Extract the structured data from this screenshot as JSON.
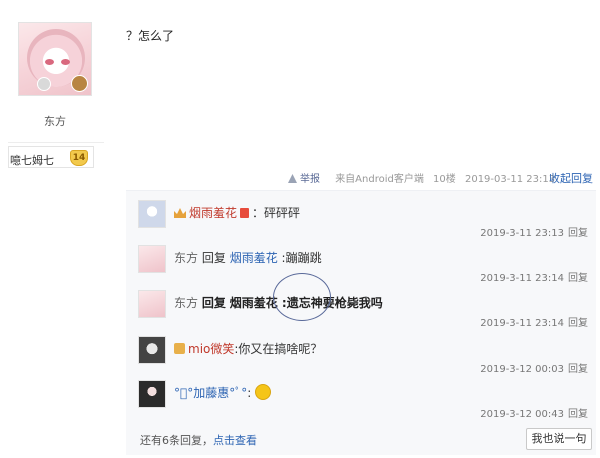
{
  "post": {
    "author": "东方",
    "level_name": "噫七姆七",
    "level_num": "14",
    "text": "？怎么了",
    "report": "举报",
    "source": "来自Android客户端",
    "floor": "10楼",
    "time": "2019-03-11 23:13",
    "collapse": "收起回复"
  },
  "comments": [
    {
      "name": "烟雨羞花",
      "colon": "：",
      "text": "砰砰砰",
      "time": "2019-3-11 23:13",
      "reply": "回复"
    },
    {
      "name": "东方",
      "reply_word": "回复",
      "target": "烟雨羞花",
      "colon": " :",
      "text": "蹦蹦跳",
      "time": "2019-3-11 23:14",
      "reply": "回复"
    },
    {
      "name": "东方",
      "reply_word": "回复",
      "target": "烟雨羞花",
      "colon": " :",
      "text": "遗忘神要枪毙我吗",
      "time": "2019-3-11 23:14",
      "reply": "回复"
    },
    {
      "name": "mio微笑",
      "colon": ":",
      "text": "你又在搞啥呢？",
      "time": "2019-3-12 00:03",
      "reply": "回复"
    },
    {
      "name": "°ﾟ°加藤惠°ﾟ°",
      "colon": ":",
      "text": "",
      "time": "2019-3-12 00:43",
      "reply": "回复"
    }
  ],
  "footer": {
    "prefix": "还有6条回复，",
    "link": "点击查看",
    "say_button": "我也说一句"
  }
}
